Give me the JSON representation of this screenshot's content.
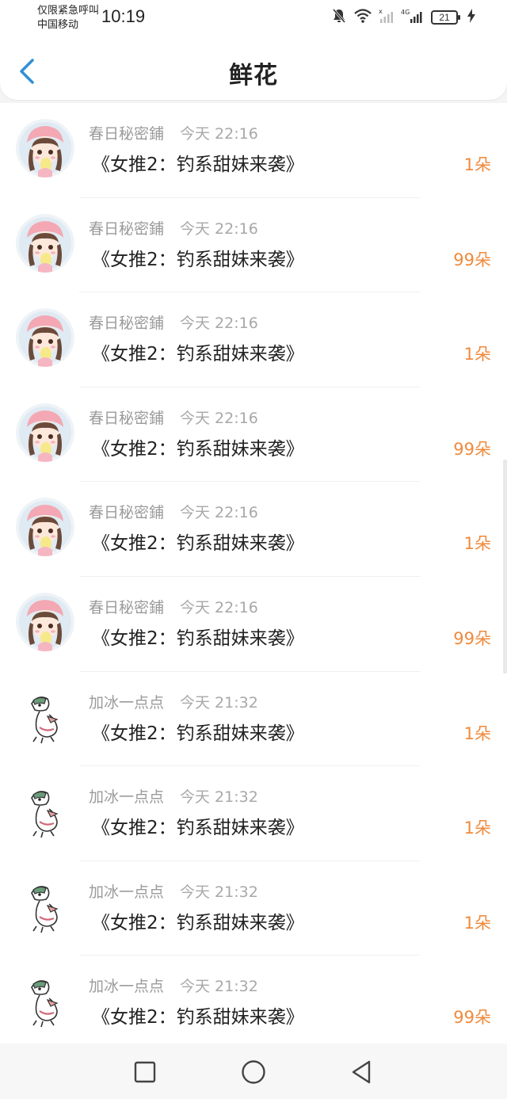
{
  "status_bar": {
    "carrier_line1": "仅限紧急呼叫",
    "carrier_line2": "中国移动",
    "time": "10:19",
    "network": "4G",
    "battery": "21",
    "icons": [
      "mute-bell-icon",
      "wifi-icon",
      "signal-icon",
      "battery-icon",
      "charging-icon"
    ]
  },
  "header": {
    "back_icon": "chevron-left-icon",
    "title": "鲜花",
    "accent_color": "#2f8fd8"
  },
  "colors": {
    "count": "#f08a3c",
    "sender": "#9b9b9b",
    "title": "#222222"
  },
  "list": {
    "items": [
      {
        "sender": "春日秘密鋪",
        "time": "今天 22:16",
        "title": "《女推2：钓系甜妹来袭》",
        "count": "1朵",
        "avatar": "girl-avatar"
      },
      {
        "sender": "春日秘密鋪",
        "time": "今天 22:16",
        "title": "《女推2：钓系甜妹来袭》",
        "count": "99朵",
        "avatar": "girl-avatar"
      },
      {
        "sender": "春日秘密鋪",
        "time": "今天 22:16",
        "title": "《女推2：钓系甜妹来袭》",
        "count": "1朵",
        "avatar": "girl-avatar"
      },
      {
        "sender": "春日秘密鋪",
        "time": "今天 22:16",
        "title": "《女推2：钓系甜妹来袭》",
        "count": "99朵",
        "avatar": "girl-avatar"
      },
      {
        "sender": "春日秘密鋪",
        "time": "今天 22:16",
        "title": "《女推2：钓系甜妹来袭》",
        "count": "1朵",
        "avatar": "girl-avatar"
      },
      {
        "sender": "春日秘密鋪",
        "time": "今天 22:16",
        "title": "《女推2：钓系甜妹来袭》",
        "count": "99朵",
        "avatar": "girl-avatar"
      },
      {
        "sender": "加冰一点点",
        "time": "今天 21:32",
        "title": "《女推2：钓系甜妹来袭》",
        "count": "1朵",
        "avatar": "duck-avatar"
      },
      {
        "sender": "加冰一点点",
        "time": "今天 21:32",
        "title": "《女推2：钓系甜妹来袭》",
        "count": "1朵",
        "avatar": "duck-avatar"
      },
      {
        "sender": "加冰一点点",
        "time": "今天 21:32",
        "title": "《女推2：钓系甜妹来袭》",
        "count": "1朵",
        "avatar": "duck-avatar"
      },
      {
        "sender": "加冰一点点",
        "time": "今天 21:32",
        "title": "《女推2：钓系甜妹来袭》",
        "count": "99朵",
        "avatar": "duck-avatar"
      }
    ]
  },
  "nav_bar": {
    "icons": [
      "recents-square-icon",
      "home-circle-icon",
      "back-triangle-icon"
    ]
  }
}
